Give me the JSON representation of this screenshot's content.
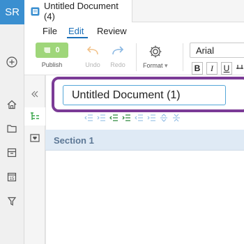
{
  "user": {
    "initials": "SR"
  },
  "tab": {
    "title": "Untitled Document (4)"
  },
  "menu": {
    "items": [
      "File",
      "Edit",
      "Review"
    ],
    "active": "Edit"
  },
  "ribbon": {
    "publish": {
      "label": "Publish",
      "count": "0"
    },
    "undo": {
      "label": "Undo"
    },
    "redo": {
      "label": "Redo"
    },
    "format": {
      "label": "Format"
    },
    "font": {
      "value": "Arial"
    },
    "format_buttons": [
      "B",
      "I",
      "U"
    ]
  },
  "rail": {
    "icons": [
      "add-icon",
      "home-icon",
      "folder-icon",
      "archive-icon",
      "calendar-icon",
      "filter-icon"
    ],
    "calendar_day": "15"
  },
  "panel": {
    "icons": [
      "collapse-icon",
      "outline-icon",
      "comment-heart-icon"
    ]
  },
  "editor": {
    "title_value": "Untitled Document (1)",
    "section_label": "Section 1"
  },
  "colors": {
    "accent": "#1a6fb8",
    "avatar": "#3a8fd0",
    "publish": "#9fd67a",
    "highlight": "#7b3b96",
    "section_bg": "#dfeaf5"
  }
}
